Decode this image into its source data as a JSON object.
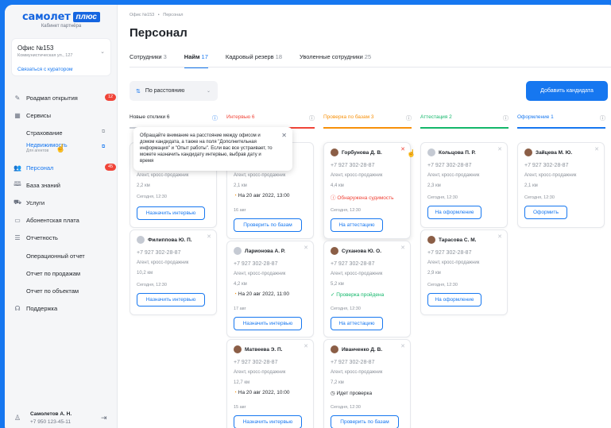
{
  "brand": {
    "name": "самолет",
    "plus": "плюс",
    "subtitle": "Кабинет партнёра"
  },
  "office": {
    "name": "Офис №153",
    "address": "Коммунистическая ул., 127",
    "link": "Связаться с куратором"
  },
  "nav": {
    "roadmap": "Роадмап открытия",
    "roadmap_badge": "12",
    "services": "Сервисы",
    "insurance": "Страхование",
    "realty": "Недвижимость",
    "realty_sub": "Для агентов",
    "staff": "Персонал",
    "staff_badge": "45",
    "knowledge": "База знаний",
    "uslugi": "Услуги",
    "fee": "Абонентская плата",
    "reports": "Отчетность",
    "op_report": "Операционный отчет",
    "sales_report": "Отчет по продажам",
    "obj_report": "Отчет по объектам",
    "support": "Поддержка"
  },
  "user": {
    "name": "Самолетов А. Н.",
    "phone": "+7 950 123-45-11"
  },
  "page": {
    "breadcrumb_1": "Офис №153",
    "breadcrumb_sep": "•",
    "breadcrumb_2": "Персонал",
    "title": "Персонал"
  },
  "tabs": [
    {
      "label": "Сотрудники",
      "count": "3"
    },
    {
      "label": "Найм",
      "count": "17"
    },
    {
      "label": "Кадровый резерв",
      "count": "18"
    },
    {
      "label": "Уволенные сотрудники",
      "count": "25"
    }
  ],
  "toolbar": {
    "sort_label": "По расстоянию",
    "add_label": "Добавить кандидата"
  },
  "columns": [
    {
      "title": "Новые отклики 6",
      "color": "#1f2329",
      "line": "#c9cdd4"
    },
    {
      "title": "Интервью 6",
      "color": "#f04438",
      "line": "#f04438"
    },
    {
      "title": "Проверка по базам 3",
      "color": "#f79009",
      "line": "#f79009"
    },
    {
      "title": "Аттестация 2",
      "color": "#12b76a",
      "line": "#12b76a"
    },
    {
      "title": "Оформление 1",
      "color": "#1677f0",
      "line": "#1677f0"
    }
  ],
  "tooltip": "Обращайте внимание на расстояние между офисом и домом кандидата, а также на поля \"Дополнительная информация\" и \"Опыт работы\". Если вас все устраивает, то можете назначить кандидату интервью, выбрав дату и время",
  "common": {
    "phone": "+7 927 302-28-87",
    "role": "Агент, кросс-продажник"
  },
  "cards": {
    "c1": {
      "km": "2,2 км",
      "date": "Сегодня, 12:30",
      "btn": "Назначить интервью"
    },
    "c2": {
      "name": "Филиппова Ю. П.",
      "km": "10,2 км",
      "date": "Сегодня, 12:30",
      "btn": "Назначить интервью"
    },
    "i1": {
      "km": "2,1 км",
      "event": "На 20 авг 2022, 13:00",
      "date": "16 авг",
      "btn": "Проверить по базам"
    },
    "i2": {
      "name": "Ларионова А. Р.",
      "km": "4,2 км",
      "event": "На 20 авг 2022, 11:00",
      "date": "17 авг",
      "btn": "Назначить интервью"
    },
    "i3": {
      "name": "Матвеева Э. П.",
      "km": "12,7 км",
      "event": "На 20 авг 2022, 10:00",
      "date": "15 авг",
      "btn": "Назначить интервью"
    },
    "p1": {
      "name": "Горбунова Д. В.",
      "km": "4,4 км",
      "status": "Обнаружена судимость",
      "date": "Сегодня, 12:30",
      "btn": "На аттестацию"
    },
    "p2": {
      "name": "Суханова Ю. О.",
      "km": "5,2 км",
      "status": "Проверка пройдена",
      "date": "Сегодня, 12:30",
      "btn": "На аттестацию"
    },
    "p3": {
      "name": "Иванченко Д. В.",
      "km": "7,2 км",
      "status": "Идет проверка",
      "date": "Сегодня, 12:30",
      "btn": "Проверить по базам"
    },
    "a1": {
      "name": "Кольцова П. Р.",
      "km": "2,3 км",
      "date": "Сегодня, 12:30",
      "btn": "На оформление"
    },
    "a2": {
      "name": "Тарасова С. М.",
      "km": "2,9 км",
      "date": "Сегодня, 12:30",
      "btn": "На оформление"
    },
    "o1": {
      "name": "Зайцева М. Ю.",
      "km": "2,1 км",
      "date": "Сегодня, 12:30",
      "btn": "Оформить"
    }
  }
}
